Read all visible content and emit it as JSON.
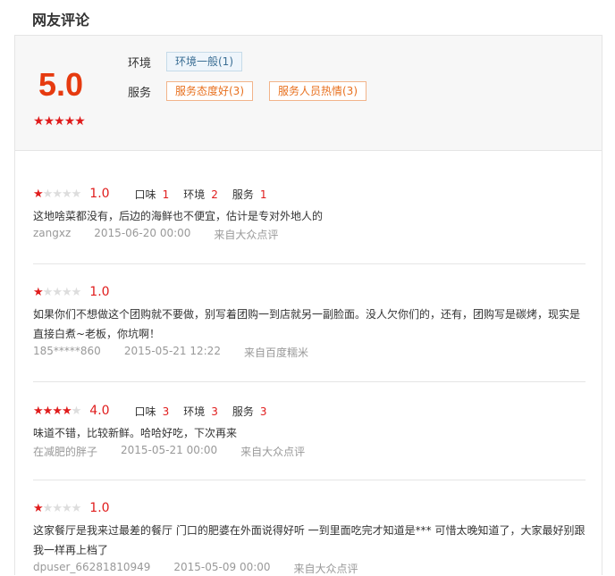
{
  "section_title": "网友评论",
  "summary": {
    "score": "5.0",
    "stars": 5,
    "environment_label": "环境",
    "environment_tags": [
      "环境一般(1)"
    ],
    "service_label": "服务",
    "service_tags": [
      "服务态度好(3)",
      "服务人员热情(3)"
    ]
  },
  "reviews": [
    {
      "stars": 1,
      "score": "1.0",
      "has_sub": true,
      "taste_label": "口味",
      "taste": "1",
      "env_label": "环境",
      "env": "2",
      "service_label": "服务",
      "service": "1",
      "text": "这地啥菜都没有，后边的海鲜也不便宜，估计是专对外地人的",
      "user": "zangxz",
      "time": "2015-06-20 00:00",
      "source": "来自大众点评"
    },
    {
      "stars": 1,
      "score": "1.0",
      "has_sub": false,
      "text": "如果你们不想做这个团购就不要做，别写着团购一到店就另一副脸面。没人欠你们的，还有，团购写是碳烤，现实是直接白煮~老板，你坑啊！",
      "user": "185*****860",
      "time": "2015-05-21 12:22",
      "source": "来自百度糯米"
    },
    {
      "stars": 4,
      "score": "4.0",
      "has_sub": true,
      "taste_label": "口味",
      "taste": "3",
      "env_label": "环境",
      "env": "3",
      "service_label": "服务",
      "service": "3",
      "text": "味道不错，比较新鲜。哈哈好吃，下次再来",
      "user": "在减肥的胖子",
      "time": "2015-05-21 00:00",
      "source": "来自大众点评"
    },
    {
      "stars": 1,
      "score": "1.0",
      "has_sub": false,
      "text": "这家餐厅是我来过最差的餐厅 门口的肥婆在外面说得好听 一到里面吃完才知道是*** 可惜太晚知道了，大家最好别跟我一样再上档了",
      "user": "dpuser_66281810949",
      "time": "2015-05-09 00:00",
      "source": "来自大众点评"
    }
  ]
}
